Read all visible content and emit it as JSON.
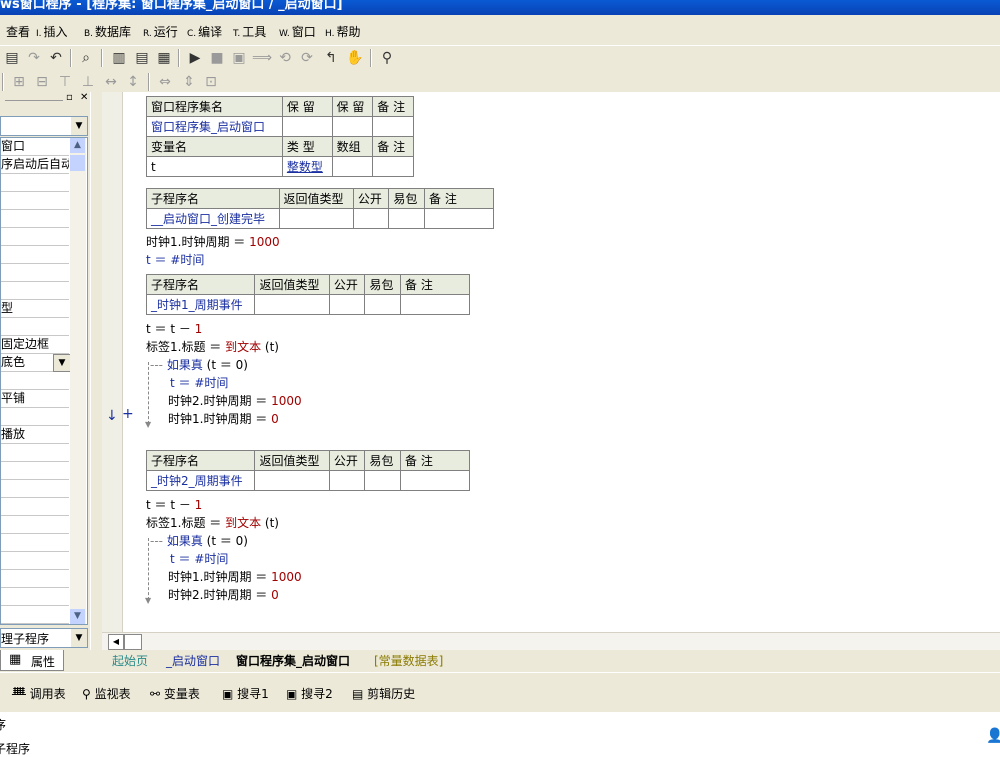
{
  "title": "ws窗口程序 - [程序集: 窗口程序集_启动窗口 / _启动窗口]",
  "menu": [
    {
      "label": "查看",
      "acc": ""
    },
    {
      "label": "插入",
      "acc": "I."
    },
    {
      "label": "数据库",
      "acc": "B."
    },
    {
      "label": "运行",
      "acc": "R."
    },
    {
      "label": "编译",
      "acc": "C."
    },
    {
      "label": "工具",
      "acc": "T."
    },
    {
      "label": "窗口",
      "acc": "W."
    },
    {
      "label": "帮助",
      "acc": "H."
    }
  ],
  "left_panel": {
    "rows": [
      "窗口",
      "序启动后自动",
      "",
      "",
      "",
      "",
      "",
      "",
      "",
      "型",
      "",
      "固定边框",
      "底色",
      "",
      "平铺",
      "",
      "播放",
      "",
      "",
      "",
      "",
      "",
      "",
      "",
      "",
      "",
      "",
      "",
      ""
    ],
    "bottom_select": "理子程序",
    "tab_label": "属性"
  },
  "editor": {
    "assembly_table": {
      "headers": [
        "窗口程序集名",
        "保 留",
        "保 留",
        "备 注"
      ],
      "row": [
        "窗口程序集_启动窗口",
        "",
        "",
        ""
      ],
      "var_headers": [
        "变量名",
        "类 型",
        "数组",
        "备 注"
      ],
      "var_row": [
        "t",
        "整数型",
        "",
        ""
      ]
    },
    "sub1": {
      "headers": [
        "子程序名",
        "返回值类型",
        "公开",
        "易包",
        "备 注"
      ],
      "row": [
        "__启动窗口_创建完毕",
        "",
        "",
        "",
        ""
      ],
      "lines": [
        "时钟1.时钟周期 ＝ ",
        "1000",
        "t ＝ #时间"
      ]
    },
    "sub2": {
      "headers": [
        "子程序名",
        "返回值类型",
        "公开",
        "易包",
        "备 注"
      ],
      "row": [
        "_时钟1_周期事件",
        "",
        "",
        "",
        ""
      ],
      "line1": "t ＝ t － ",
      "line1_num": "1",
      "line2": "标签1.标题 ＝ ",
      "line2_fn": "到文本",
      "line2_arg": " (t)",
      "if_kw": "如果真",
      "if_cond": " (t ＝ 0)",
      "body1": "t ＝ #时间",
      "body2": "时钟2.时钟周期 ＝ ",
      "body2_num": "1000",
      "body3": "时钟1.时钟周期 ＝ ",
      "body3_num": "0"
    },
    "sub3": {
      "headers": [
        "子程序名",
        "返回值类型",
        "公开",
        "易包",
        "备 注"
      ],
      "row": [
        "_时钟2_周期事件",
        "",
        "",
        "",
        ""
      ],
      "line1": "t ＝ t － ",
      "line1_num": "1",
      "line2": "标签1.标题 ＝ ",
      "line2_fn": "到文本",
      "line2_arg": " (t)",
      "if_kw": "如果真",
      "if_cond": " (t ＝ 0)",
      "body1": "t ＝ #时间",
      "body2": "时钟1.时钟周期 ＝ ",
      "body2_num": "1000",
      "body3": "时钟2.时钟周期 ＝ ",
      "body3_num": "0"
    }
  },
  "tabs": [
    "起始页",
    "_启动窗口",
    "窗口程序集_启动窗口",
    "[常量数据表]"
  ],
  "panels": [
    "调用表",
    "监视表",
    "变量表",
    "搜寻1",
    "搜寻2",
    "剪辑历史"
  ],
  "status": [
    "序",
    "子程序"
  ]
}
